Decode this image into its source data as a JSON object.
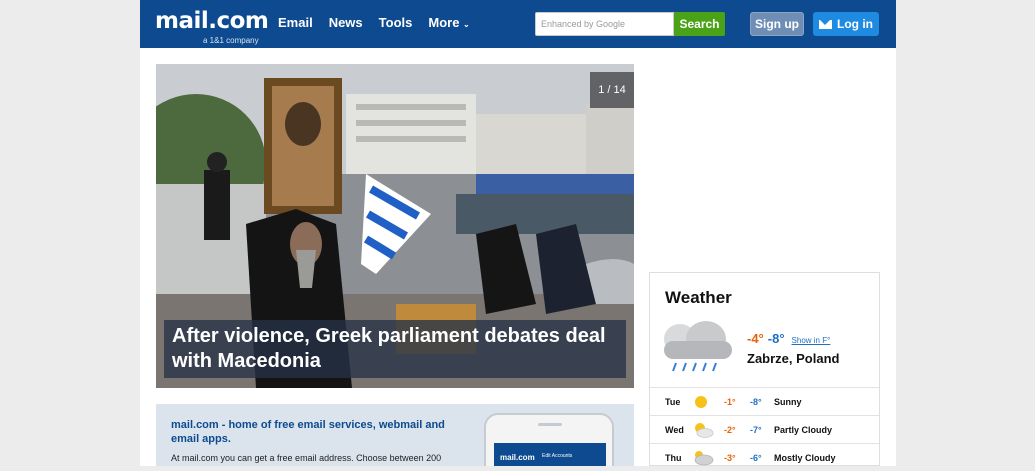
{
  "header": {
    "logo": "mail.com",
    "tagline": "a 1&1 company",
    "nav": [
      "Email",
      "News",
      "Tools",
      "More"
    ],
    "search_placeholder": "Enhanced by Google",
    "search_button": "Search",
    "signup": "Sign up",
    "login": "Log in"
  },
  "hero": {
    "counter": "1 / 14",
    "headline": "After violence, Greek parliament debates deal with Macedonia"
  },
  "promo": {
    "title": "mail.com - home of free email services, webmail and email apps.",
    "text": "At mail.com you can get a free email address. Choose between 200",
    "phone_logo": "mail.com",
    "phone_tab": "Edit Accounts"
  },
  "weather": {
    "title": "Weather",
    "now_hi": "-4°",
    "now_lo": "-8°",
    "unit_link": "Show in F°",
    "location": "Zabrze, Poland",
    "forecast": [
      {
        "day": "Tue",
        "hi": "-1°",
        "lo": "-8°",
        "desc": "Sunny",
        "icon": "sun-icon"
      },
      {
        "day": "Wed",
        "hi": "-2°",
        "lo": "-7°",
        "desc": "Partly Cloudy",
        "icon": "partly-cloudy-icon"
      },
      {
        "day": "Thu",
        "hi": "-3°",
        "lo": "-6°",
        "desc": "Mostly Cloudy",
        "icon": "mostly-cloudy-icon"
      }
    ]
  },
  "colors": {
    "brand_blue": "#0d4a8f",
    "search_green": "#4aa317",
    "login_blue": "#1e8be0",
    "temp_high": "#e8620a",
    "temp_low": "#1e6fc6"
  }
}
